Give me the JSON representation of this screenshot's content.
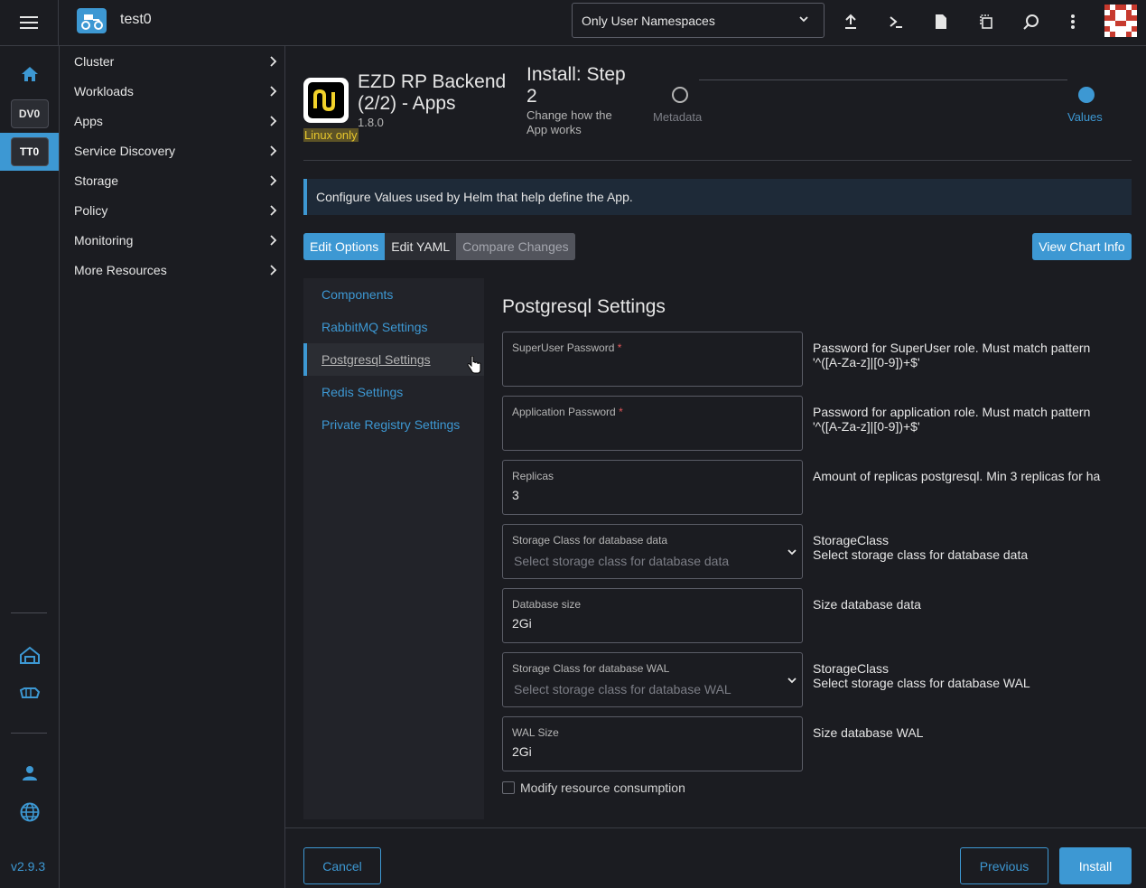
{
  "header": {
    "cluster_name": "test0",
    "namespace_filter": "Only User Namespaces"
  },
  "rail": {
    "clusters": [
      {
        "label": "DV0"
      },
      {
        "label": "TT0"
      }
    ],
    "version": "v2.9.3"
  },
  "sidenav": {
    "items": [
      {
        "label": "Cluster"
      },
      {
        "label": "Workloads"
      },
      {
        "label": "Apps"
      },
      {
        "label": "Service Discovery"
      },
      {
        "label": "Storage"
      },
      {
        "label": "Policy"
      },
      {
        "label": "Monitoring"
      },
      {
        "label": "More Resources"
      }
    ]
  },
  "app": {
    "title": "EZD RP Backend (2/2) - Apps",
    "version": "1.8.0",
    "os_badge": "Linux only"
  },
  "wizard": {
    "step_title": "Install: Step 2",
    "step_subtitle": "Change how the App works",
    "steps": [
      {
        "label": "Metadata",
        "active": false
      },
      {
        "label": "Values",
        "active": true
      }
    ]
  },
  "banner": {
    "text": "Configure Values used by Helm that help define the App."
  },
  "tabs": [
    {
      "label": "Edit Options"
    },
    {
      "label": "Edit YAML"
    },
    {
      "label": "Compare Changes"
    }
  ],
  "view_chart_info": "View Chart Info",
  "sections": [
    {
      "label": "Components"
    },
    {
      "label": "RabbitMQ Settings"
    },
    {
      "label": "Postgresql Settings"
    },
    {
      "label": "Redis Settings"
    },
    {
      "label": "Private Registry Settings"
    }
  ],
  "form": {
    "title": "Postgresql Settings",
    "fields": [
      {
        "label": "SuperUser Password",
        "required": "*",
        "value": "",
        "description": "Password for SuperUser role. Must match pattern '^([A-Za-z]|[0-9])+$'"
      },
      {
        "label": "Application Password",
        "required": "*",
        "value": "",
        "description": "Password for application role. Must match pattern '^([A-Za-z]|[0-9])+$'"
      },
      {
        "label": "Replicas",
        "value": "3",
        "description": "Amount of replicas postgresql. Min 3 replicas for ha"
      },
      {
        "label": "Storage Class for database data",
        "placeholder": "Select storage class for database data",
        "description_title": "StorageClass",
        "description": "Select storage class for database data"
      },
      {
        "label": "Database size",
        "value": "2Gi",
        "description": "Size database data"
      },
      {
        "label": "Storage Class for database WAL",
        "placeholder": "Select storage class for database WAL",
        "description_title": "StorageClass",
        "description": "Select storage class for database WAL"
      },
      {
        "label": "WAL Size",
        "value": "2Gi",
        "description": "Size database WAL"
      }
    ],
    "checkbox_label": "Modify resource consumption"
  },
  "footer": {
    "cancel": "Cancel",
    "previous": "Previous",
    "install": "Install"
  },
  "colors": {
    "accent": "#3d98d3",
    "background": "#1b1c21",
    "badge": "#e8c72c"
  }
}
